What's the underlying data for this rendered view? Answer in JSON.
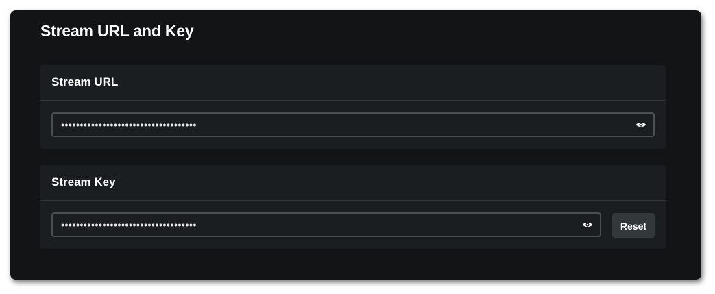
{
  "panel": {
    "title": "Stream URL and Key"
  },
  "stream_url": {
    "label": "Stream URL",
    "masked_value": "••••••••••••••••••••••••••••••••••••",
    "toggle_icon": "eye-icon"
  },
  "stream_key": {
    "label": "Stream Key",
    "masked_value": "••••••••••••••••••••••••••••••••••••",
    "toggle_icon": "eye-icon",
    "reset_label": "Reset"
  },
  "colors": {
    "panel_bg": "#131415",
    "card_bg": "#1a1e20",
    "input_border": "#4a4f53",
    "button_bg": "#33383b",
    "text": "#ffffff"
  }
}
